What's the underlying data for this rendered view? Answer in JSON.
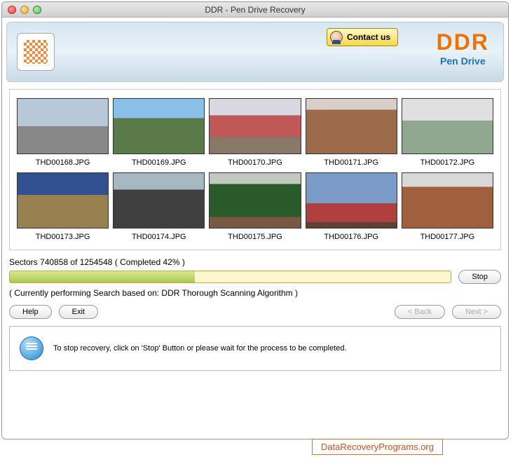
{
  "window": {
    "title": "DDR - Pen Drive Recovery"
  },
  "header": {
    "contact_label": "Contact us",
    "brand_main": "DDR",
    "brand_sub": "Pen Drive"
  },
  "thumbnails": [
    {
      "label": "THD00168.JPG",
      "cls": "t168"
    },
    {
      "label": "THD00169.JPG",
      "cls": "t169"
    },
    {
      "label": "THD00170.JPG",
      "cls": "t170"
    },
    {
      "label": "THD00171.JPG",
      "cls": "t171"
    },
    {
      "label": "THD00172.JPG",
      "cls": "t172"
    },
    {
      "label": "THD00173.JPG",
      "cls": "t173"
    },
    {
      "label": "THD00174.JPG",
      "cls": "t174"
    },
    {
      "label": "THD00175.JPG",
      "cls": "t175"
    },
    {
      "label": "THD00176.JPG",
      "cls": "t176"
    },
    {
      "label": "THD00177.JPG",
      "cls": "t177"
    }
  ],
  "progress": {
    "text": "Sectors 740858 of 1254548   ( Completed 42% )",
    "percent": 42,
    "stop_label": "Stop",
    "algo_text": "( Currently performing Search based on: DDR Thorough Scanning Algorithm )"
  },
  "buttons": {
    "help": "Help",
    "exit": "Exit",
    "back": "< Back",
    "next": "Next >"
  },
  "hint": {
    "text": "To stop recovery, click on 'Stop' Button or please wait for the process to be completed."
  },
  "footer": {
    "link": "DataRecoveryPrograms.org"
  }
}
